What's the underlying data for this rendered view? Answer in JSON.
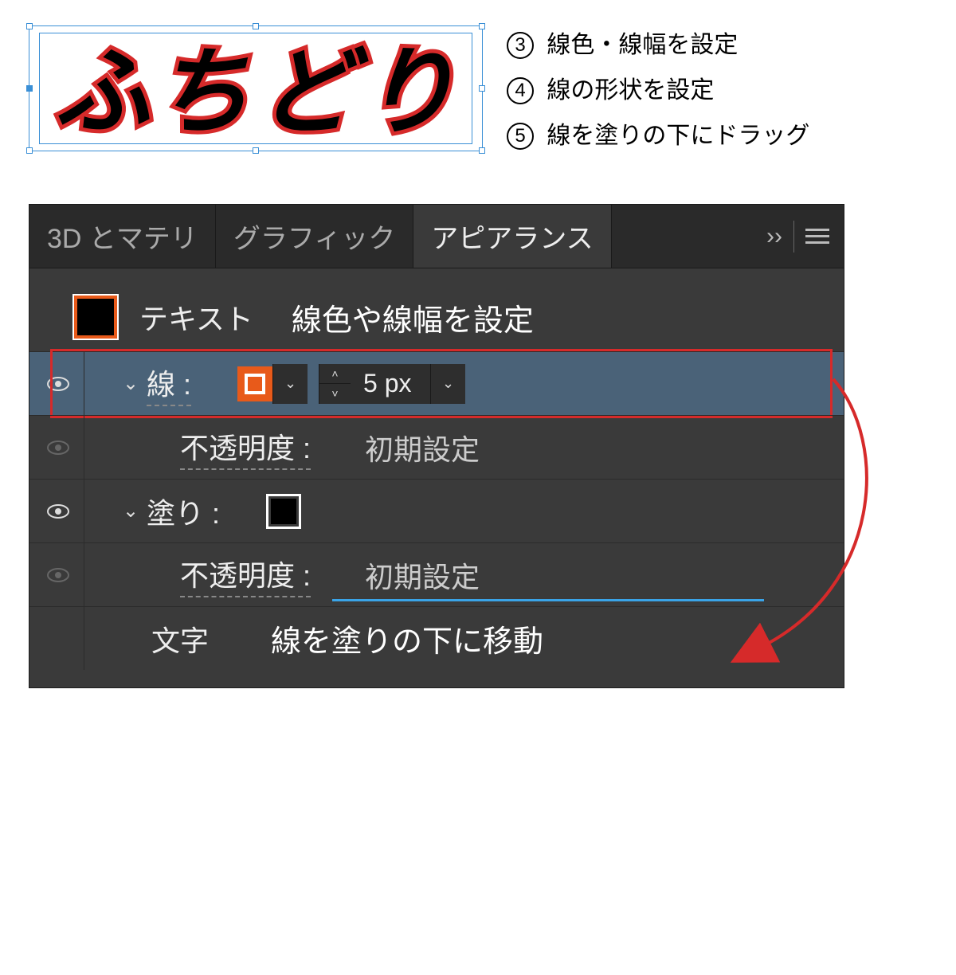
{
  "sample_text": "ふちどり",
  "instructions": [
    {
      "num": "3",
      "text": "線色・線幅を設定"
    },
    {
      "num": "4",
      "text": "線の形状を設定"
    },
    {
      "num": "5",
      "text": "線を塗りの下にドラッグ"
    }
  ],
  "panel": {
    "tabs": {
      "t1": "3D とマテリ",
      "t2": "グラフィック",
      "t3": "アピアランス"
    },
    "more_glyph": "››",
    "header": {
      "label": "テキスト",
      "annotation": "線色や線幅を設定"
    },
    "stroke": {
      "label": "線 :",
      "value": "5 px"
    },
    "opacity_label": "不透明度 :",
    "opacity_value": "初期設定",
    "fill": {
      "label": "塗り :"
    },
    "footer": {
      "label": "文字",
      "annotation": "線を塗りの下に移動"
    }
  }
}
